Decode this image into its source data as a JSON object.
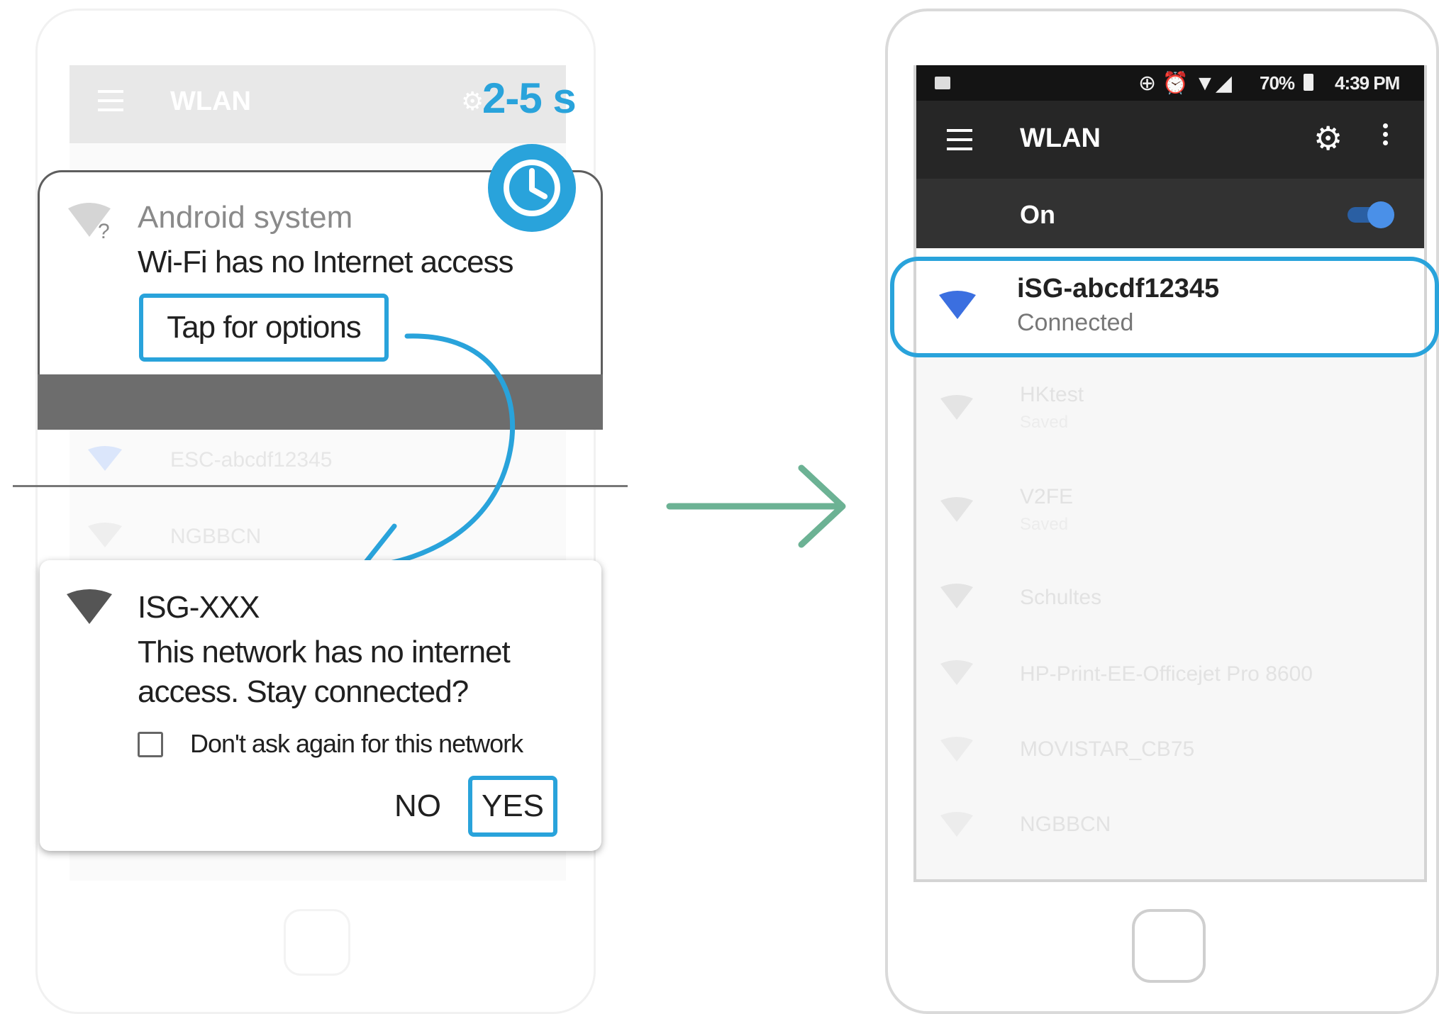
{
  "left_phone": {
    "background_screen": {
      "title": "WLAN",
      "networks": [
        "ESC-abcdf12345",
        "NGBBCN"
      ]
    },
    "timing_label": "2-5 s",
    "notification": {
      "app_name": "Android system",
      "title": "Wi-Fi has no Internet access",
      "action": "Tap for options"
    },
    "dialog": {
      "ssid": "ISG-XXX",
      "message": "This network has no internet access. Stay connected?",
      "checkbox_label": "Don't ask again for this network",
      "checkbox_checked": false,
      "no_label": "NO",
      "yes_label": "YES"
    }
  },
  "right_phone": {
    "status_bar": {
      "battery": "70%",
      "time": "4:39 PM"
    },
    "app_bar": {
      "title": "WLAN"
    },
    "wlan_switch": {
      "label": "On",
      "enabled": true
    },
    "connected_network": {
      "ssid": "iSG-abcdf12345",
      "status": "Connected"
    },
    "other_networks": [
      {
        "ssid": "HKtest",
        "status": "Saved"
      },
      {
        "ssid": "V2FE",
        "status": "Saved"
      },
      {
        "ssid": "Schultes",
        "status": ""
      },
      {
        "ssid": "HP-Print-EE-Officejet Pro 8600",
        "status": ""
      },
      {
        "ssid": "MOVISTAR_CB75",
        "status": ""
      },
      {
        "ssid": "NGBBCN",
        "status": ""
      }
    ]
  },
  "colors": {
    "highlight": "#29a3db",
    "arrow_flow": "#6cb294",
    "wifi_connected": "#3b6fe0"
  }
}
